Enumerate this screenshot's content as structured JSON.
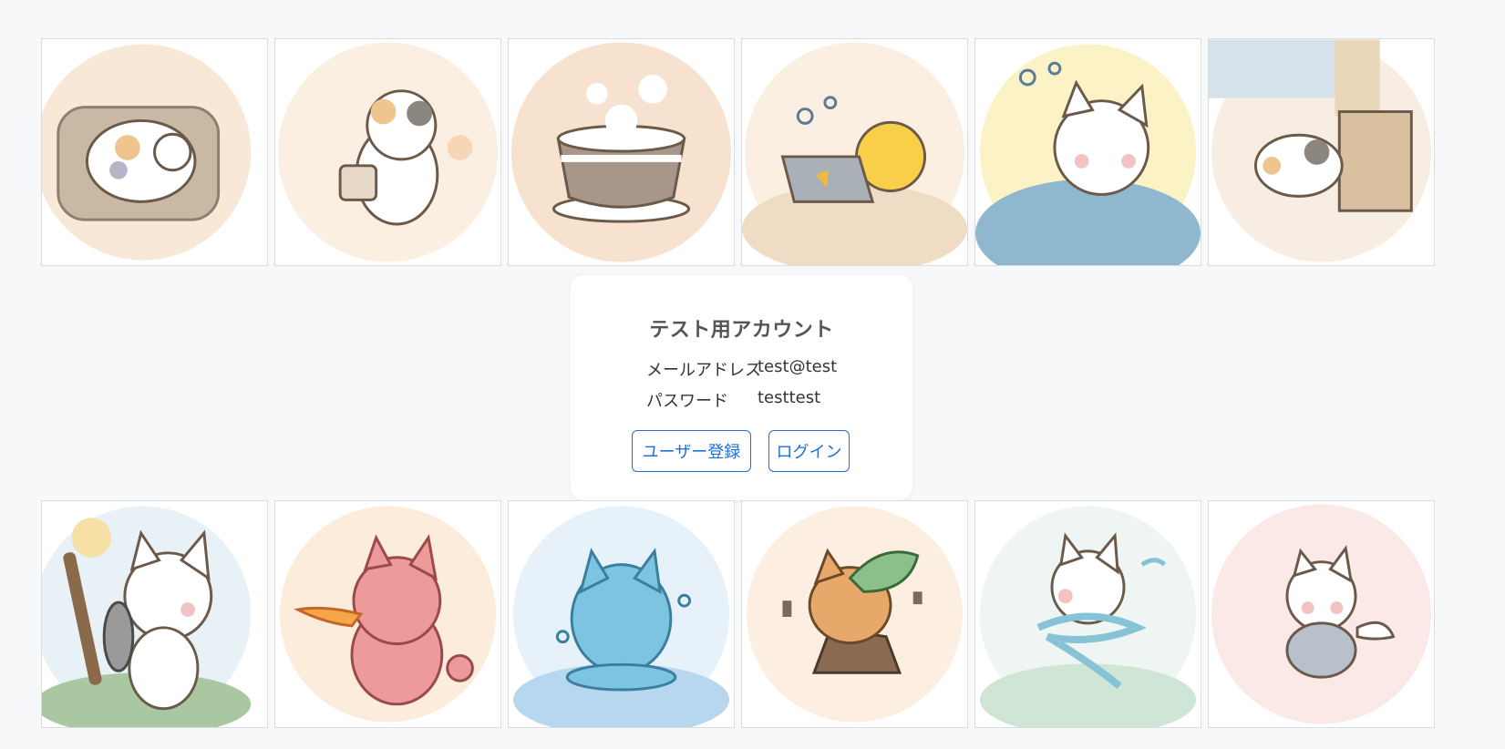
{
  "login_card": {
    "title": "テスト用アカウント",
    "email_label": "メールアドレス",
    "email_value": "test@test",
    "password_label": "パスワード",
    "password_value": "testtest",
    "register_button": "ユーザー登録",
    "login_button": "ログイン"
  },
  "colors": {
    "accent": "#1f6fd6",
    "page_background": "#f7f8fa"
  },
  "gallery": {
    "top_row": [
      "cat-sleeping-on-cushion-illustration",
      "cat-holding-mug-illustration",
      "cat-latte-cup-illustration",
      "chick-with-laptop-illustration",
      "cat-relaxing-under-blanket-illustration",
      "cat-peeking-by-window-illustration"
    ],
    "bottom_row": [
      "cat-warrior-with-stick-and-shield-illustration",
      "fire-dragon-cat-illustration",
      "water-slime-cat-illustration",
      "earth-leaf-cat-illustration",
      "wind-cat-illustration",
      "angel-cat-illustration"
    ]
  }
}
